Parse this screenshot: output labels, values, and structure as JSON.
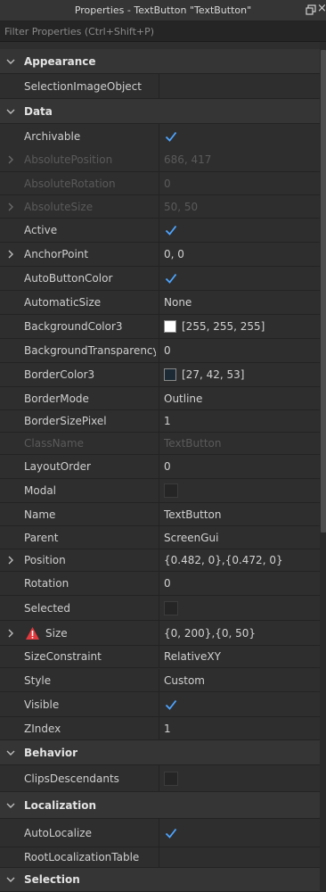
{
  "window": {
    "title": "Properties - TextButton \"TextButton\""
  },
  "filter": {
    "placeholder": "Filter Properties (Ctrl+Shift+P)"
  },
  "colors": {
    "checkmark": "#4ea4ff",
    "category_bg": "#353535",
    "row_bg": "#2e2e2e",
    "warning": "#e0393e"
  },
  "rows": [
    {
      "type": "category",
      "label": "Appearance"
    },
    {
      "type": "prop",
      "name": "SelectionImageObject",
      "value": ""
    },
    {
      "type": "category",
      "label": "Data"
    },
    {
      "type": "prop",
      "name": "Archivable",
      "kind": "check",
      "checked": true
    },
    {
      "type": "prop",
      "name": "AbsolutePosition",
      "value": "686, 417",
      "readonly": true,
      "expandable": true
    },
    {
      "type": "prop",
      "name": "AbsoluteRotation",
      "value": "0",
      "readonly": true
    },
    {
      "type": "prop",
      "name": "AbsoluteSize",
      "value": "50, 50",
      "readonly": true,
      "expandable": true
    },
    {
      "type": "prop",
      "name": "Active",
      "kind": "check",
      "checked": true
    },
    {
      "type": "prop",
      "name": "AnchorPoint",
      "value": "0, 0",
      "expandable": true
    },
    {
      "type": "prop",
      "name": "AutoButtonColor",
      "kind": "check",
      "checked": true
    },
    {
      "type": "prop",
      "name": "AutomaticSize",
      "value": "None"
    },
    {
      "type": "prop",
      "name": "BackgroundColor3",
      "kind": "color",
      "color": "#ffffff",
      "value": "[255, 255, 255]"
    },
    {
      "type": "prop",
      "name": "BackgroundTransparency",
      "value": "0"
    },
    {
      "type": "prop",
      "name": "BorderColor3",
      "kind": "color",
      "color": "#1b2a35",
      "value": "[27, 42, 53]"
    },
    {
      "type": "prop",
      "name": "BorderMode",
      "value": "Outline"
    },
    {
      "type": "prop",
      "name": "BorderSizePixel",
      "value": "1"
    },
    {
      "type": "prop",
      "name": "ClassName",
      "value": "TextButton",
      "readonly": true
    },
    {
      "type": "prop",
      "name": "LayoutOrder",
      "value": "0"
    },
    {
      "type": "prop",
      "name": "Modal",
      "kind": "check",
      "checked": false
    },
    {
      "type": "prop",
      "name": "Name",
      "value": "TextButton"
    },
    {
      "type": "prop",
      "name": "Parent",
      "value": "ScreenGui"
    },
    {
      "type": "prop",
      "name": "Position",
      "value": "{0.482, 0},{0.472, 0}",
      "expandable": true
    },
    {
      "type": "prop",
      "name": "Rotation",
      "value": "0"
    },
    {
      "type": "prop",
      "name": "Selected",
      "kind": "check",
      "checked": false
    },
    {
      "type": "prop",
      "name": "Size",
      "value": "{0, 200},{0, 50}",
      "expandable": true,
      "warning": true
    },
    {
      "type": "prop",
      "name": "SizeConstraint",
      "value": "RelativeXY"
    },
    {
      "type": "prop",
      "name": "Style",
      "value": "Custom"
    },
    {
      "type": "prop",
      "name": "Visible",
      "kind": "check",
      "checked": true
    },
    {
      "type": "prop",
      "name": "ZIndex",
      "value": "1"
    },
    {
      "type": "category",
      "label": "Behavior"
    },
    {
      "type": "prop",
      "name": "ClipsDescendants",
      "kind": "check",
      "checked": false
    },
    {
      "type": "category",
      "label": "Localization"
    },
    {
      "type": "prop",
      "name": "AutoLocalize",
      "kind": "check",
      "checked": true
    },
    {
      "type": "prop",
      "name": "RootLocalizationTable",
      "value": ""
    },
    {
      "type": "category",
      "label": "Selection"
    }
  ]
}
